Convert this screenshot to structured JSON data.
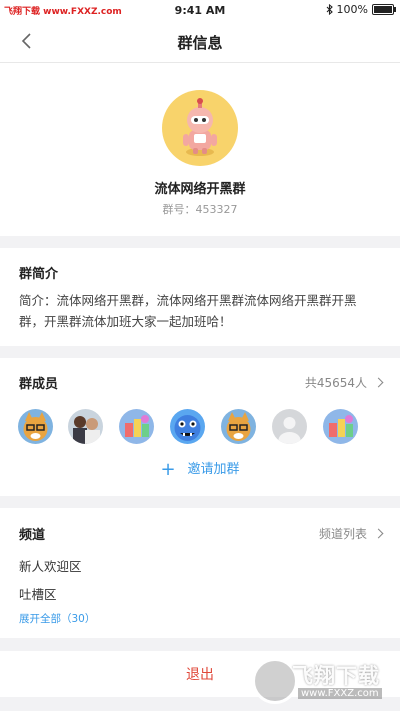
{
  "status_bar": {
    "watermark": "飞翔下载 www.FXXZ.com",
    "time": "9:41 AM",
    "battery": "100%"
  },
  "nav": {
    "title": "群信息"
  },
  "group": {
    "name": "流体网络开黑群",
    "id_text": "群号：453327"
  },
  "intro": {
    "title": "群简介",
    "text": "简介：流体网络开黑群，流体网络开黑群流体网络开黑群开黑群，开黑群流体加班大家一起加班哈！"
  },
  "members": {
    "title": "群成员",
    "count": "共45654人",
    "avatar_icons": [
      "cat-glasses-avatar",
      "people-photo-avatar",
      "toys-avatar",
      "blue-monster-avatar",
      "cat-glasses-avatar",
      "default-avatar",
      "toys-avatar"
    ],
    "invite_label": "邀请加群"
  },
  "channels": {
    "title": "频道",
    "list_link": "频道列表",
    "items": [
      "新人欢迎区",
      "吐槽区"
    ],
    "expand_label": "展开全部（30）"
  },
  "logout": {
    "label": "退出"
  },
  "watermark_logo": {
    "text": "飞翔下载",
    "url": "www.FXXZ.com"
  },
  "colors": {
    "accent_blue": "#3a9be8",
    "logout_red": "#e0483a",
    "avatar_yellow": "#f8d36b"
  }
}
